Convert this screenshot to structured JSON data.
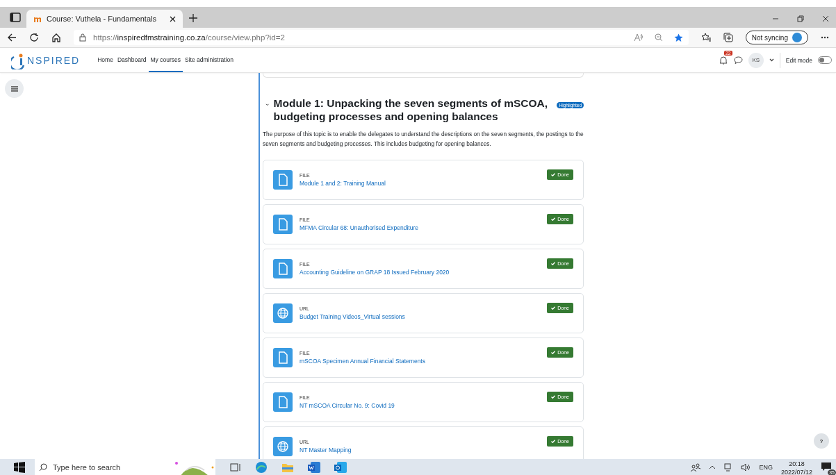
{
  "browser": {
    "tab_title": "Course: Vuthela - Fundamentals",
    "url_scheme": "https://",
    "url_host": "inspiredfmstraining.co.za",
    "url_path": "/course/view.php?id=2",
    "favorited": true,
    "sync_label": "Not syncing"
  },
  "site": {
    "logo_text": "NSPIRED",
    "nav": [
      {
        "label": "Home",
        "selected": false
      },
      {
        "label": "Dashboard",
        "selected": false
      },
      {
        "label": "My courses",
        "selected": true
      },
      {
        "label": "Site administration",
        "selected": false
      }
    ],
    "notification_count": "22",
    "avatar_initials": "KS",
    "edit_mode": {
      "label": "Edit mode",
      "on": false
    }
  },
  "section": {
    "title": "Module 1: Unpacking the seven segments of mSCOA, budgeting processes and opening balances",
    "badge": "Highlighted",
    "expanded": true,
    "summary": "The purpose of this topic is to enable the delegates to understand the descriptions on the seven segments, the postings to the seven segments and budgeting processes. This includes budgeting for opening balances.",
    "activities": [
      {
        "kind": "file",
        "type_label": "FILE",
        "name": "Module 1 and 2: Training Manual",
        "completion": "Done"
      },
      {
        "kind": "file",
        "type_label": "FILE",
        "name": "MFMA Circular 68: Unauthorised Expenditure",
        "completion": "Done"
      },
      {
        "kind": "file",
        "type_label": "FILE",
        "name": "Accounting Guideline on GRAP 18 Issued February 2020",
        "completion": "Done"
      },
      {
        "kind": "url",
        "type_label": "URL",
        "name": "Budget Training Videos_Virtual sessions",
        "completion": "Done"
      },
      {
        "kind": "file",
        "type_label": "FILE",
        "name": "mSCOA Specimen Annual Financial Statements",
        "completion": "Done"
      },
      {
        "kind": "file",
        "type_label": "FILE",
        "name": "NT mSCOA Circular No. 9: Covid 19",
        "completion": "Done"
      },
      {
        "kind": "url",
        "type_label": "URL",
        "name": "NT Master Mapping",
        "completion": "Done"
      }
    ]
  },
  "help_label": "?",
  "taskbar": {
    "search_placeholder": "Type here to search",
    "language": "ENG",
    "time": "20:18",
    "date": "2022/07/12",
    "notification_count": "35"
  }
}
